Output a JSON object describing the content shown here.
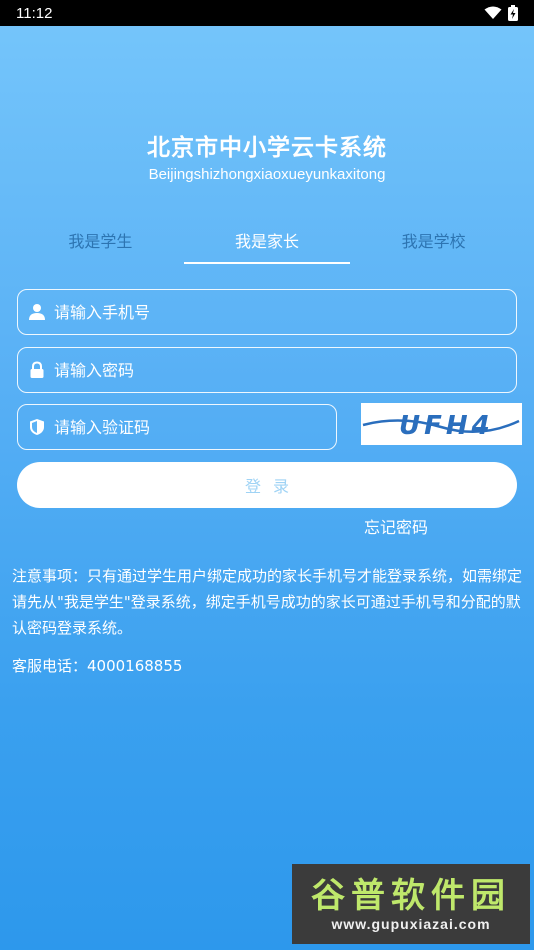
{
  "status_bar": {
    "time": "11:12"
  },
  "header": {
    "title": "北京市中小学云卡系统",
    "subtitle": "Beijingshizhongxiaoxueyunkaxitong"
  },
  "tabs": [
    {
      "label": "我是学生",
      "active": false
    },
    {
      "label": "我是家长",
      "active": true
    },
    {
      "label": "我是学校",
      "active": false
    }
  ],
  "form": {
    "phone_placeholder": "请输入手机号",
    "password_placeholder": "请输入密码",
    "captcha_placeholder": "请输入验证码",
    "captcha_text": "UFH4",
    "login_label": "登录",
    "forgot_label": "忘记密码"
  },
  "notice": {
    "text": "注意事项：只有通过学生用户绑定成功的家长手机号才能登录系统，如需绑定请先从\"我是学生\"登录系统，绑定手机号成功的家长可通过手机号和分配的默认密码登录系统。",
    "hotline": "客服电话：4000168855"
  },
  "watermark": {
    "name": "谷普软件园",
    "url": "www.gupuxiazai.com"
  },
  "colors": {
    "gradient_top": "#76c6fb",
    "gradient_bottom": "#2d98ec",
    "inactive_tab": "#3c78b4",
    "login_text": "#9fd3f5",
    "captcha_ink": "#2a6ebd"
  }
}
